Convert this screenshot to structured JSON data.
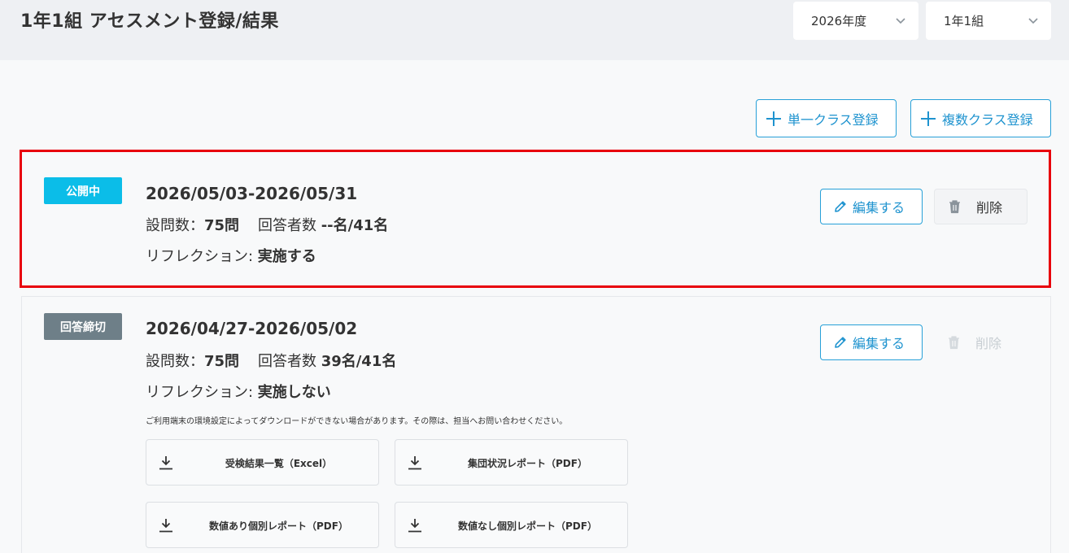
{
  "header": {
    "title": "1年1組 アセスメント登録/結果",
    "year_select": "2026年度",
    "class_select": "1年1組"
  },
  "actions": {
    "single_class_register": "単一クラス登録",
    "multi_class_register": "複数クラス登録"
  },
  "assessments": [
    {
      "status": "公開中",
      "status_color": "#0bbde8",
      "period": "2026/05/03-2026/05/31",
      "question_count_label": "設問数：",
      "question_count": "75問",
      "respondent_label": "回答者数 ",
      "respondents": "--名/41名",
      "reflection_label": "リフレクション: ",
      "reflection": "実施する",
      "edit_label": "編集する",
      "delete_label": "削除"
    },
    {
      "status": "回答締切",
      "status_color": "#6e7f88",
      "period": "2026/04/27-2026/05/02",
      "question_count_label": "設問数：",
      "question_count": "75問",
      "respondent_label": "回答者数 ",
      "respondents": "39名/41名",
      "reflection_label": "リフレクション: ",
      "reflection": "実施しない",
      "edit_label": "編集する",
      "delete_label": "削除",
      "notice": "ご利用端末の環境設定によってダウンロードができない場合があります。その際は、担当へお問い合わせください。",
      "downloads": [
        "受検結果一覧（Excel）",
        "集団状況レポート（PDF）",
        "数値あり個別レポート（PDF）",
        "数値なし個別レポート（PDF）"
      ]
    }
  ],
  "colors": {
    "accent": "#27a0d8",
    "highlight": "#e8000b"
  },
  "icons": [
    "chevron-down-icon",
    "plus-icon",
    "pencil-icon",
    "trash-icon",
    "download-icon"
  ]
}
